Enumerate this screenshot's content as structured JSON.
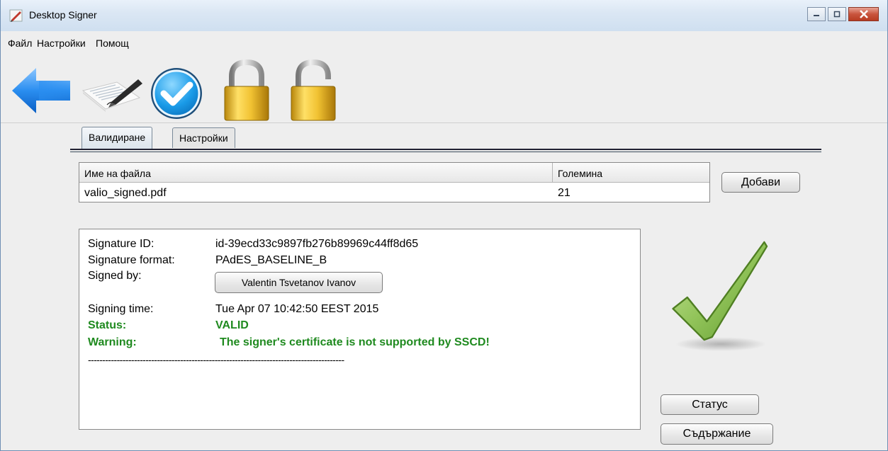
{
  "window": {
    "title": "Desktop Signer"
  },
  "menu": [
    "Файл",
    "Настройки",
    "Помощ"
  ],
  "toolbar": {
    "icons": [
      "back-arrow-icon",
      "sign-document-icon",
      "validate-check-icon",
      "lock-icon",
      "unlock-icon"
    ]
  },
  "tabs": [
    {
      "label": "Валидиране",
      "active": true
    },
    {
      "label": "Настройки",
      "active": false
    }
  ],
  "file_table": {
    "columns": [
      "Име на файла",
      "Големина"
    ],
    "rows": [
      {
        "name": "valio_signed.pdf",
        "size": "21"
      }
    ]
  },
  "buttons": {
    "add": "Добави",
    "status": "Статус",
    "content": "Съдържание"
  },
  "signature": {
    "id_label": "Signature ID:",
    "id_value": "id-39ecd33c9897fb276b89969c44ff8d65",
    "format_label": "Signature format:",
    "format_value": "PAdES_BASELINE_B",
    "signed_by_label": "Signed by:",
    "signed_by_value": "Valentin Tsvetanov Ivanov",
    "time_label": "Signing time:",
    "time_value": "Tue Apr 07 10:42:50 EEST 2015",
    "status_label": "Status:",
    "status_value": "VALID",
    "warning_label": "Warning:",
    "warning_value": "The signer's certificate is not supported by SSCD!",
    "separator": "-----------------------------------------------------------------------------------------"
  },
  "colors": {
    "status_green": "#1f8a1f",
    "check_green": "#7fb34a",
    "lock_gold": "#e4b21a",
    "title_bar": "#dbe7f4"
  }
}
